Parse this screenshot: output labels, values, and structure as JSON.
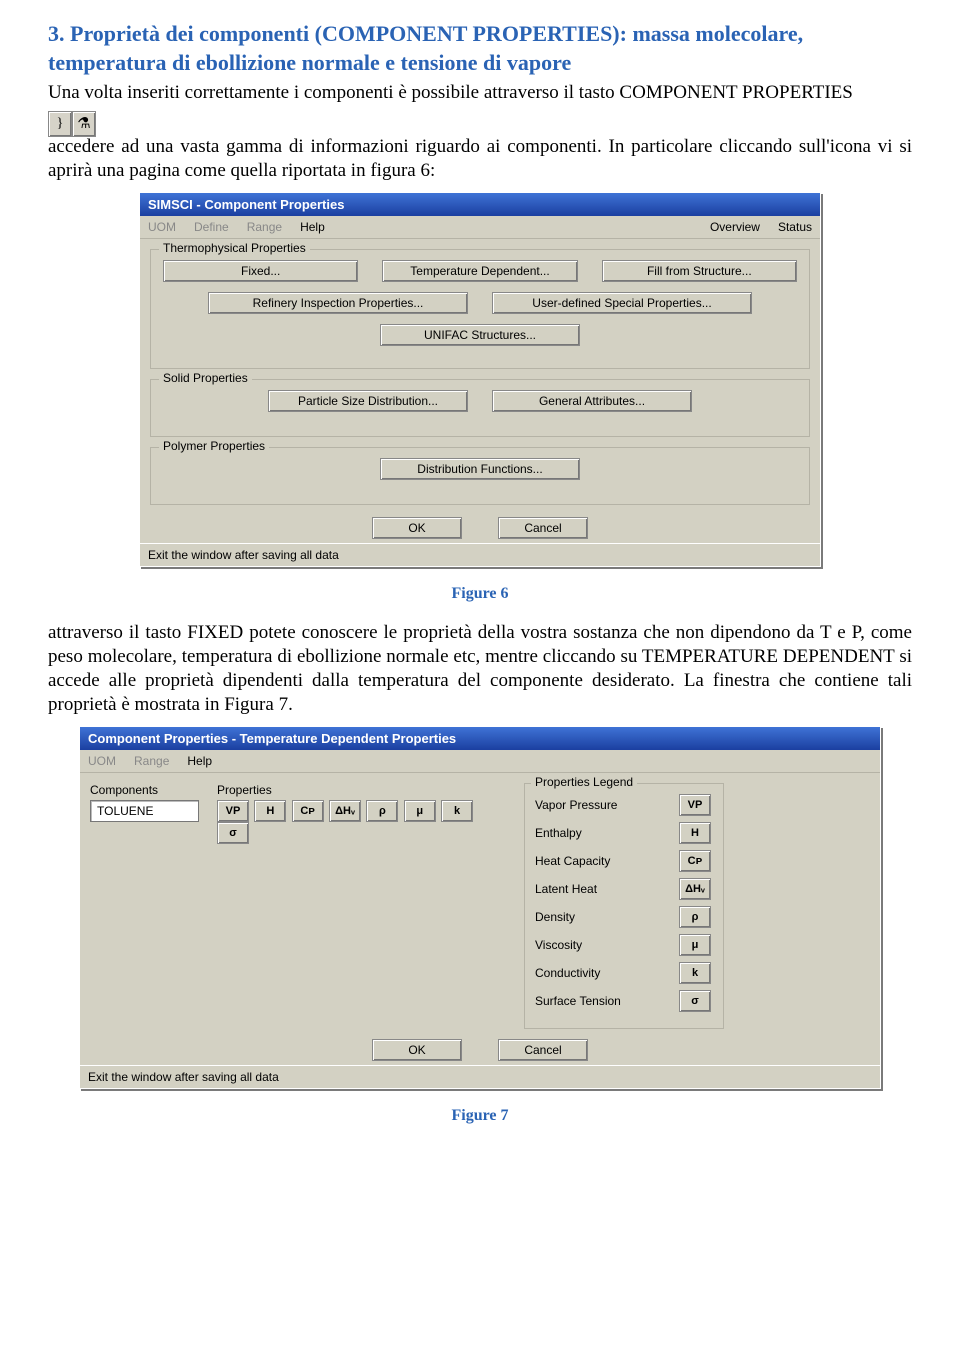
{
  "heading": "3. Proprietà dei componenti (COMPONENT PROPERTIES): massa molecolare, temperatura di ebollizione normale e tensione di vapore",
  "para1_a": "Una volta inseriti correttamente i componenti è possibile attraverso il tasto COMPONENT PROPERTIES",
  "para1_b": "accedere ad una vasta gamma di informazioni riguardo ai componenti. In particolare cliccando sull'icona vi si aprirà una pagina come quella riportata in figura 6:",
  "caption1": "Figure 6",
  "para2": "attraverso il tasto FIXED potete conoscere le proprietà della vostra sostanza che non dipendono da T e P, come peso molecolare, temperatura di ebollizione normale etc, mentre cliccando su TEMPERATURE DEPENDENT si accede alle proprietà dipendenti dalla temperatura del componente desiderato. La finestra che contiene tali proprietà è mostrata in Figura 7.",
  "caption2": "Figure 7",
  "win1": {
    "title": "SIMSCI - Component Properties",
    "menu": {
      "uom": "UOM",
      "define": "Define",
      "range": "Range",
      "help": "Help",
      "overview": "Overview",
      "status": "Status"
    },
    "thermo": {
      "legend": "Thermophysical Properties",
      "fixed": "Fixed...",
      "tempdep": "Temperature Dependent...",
      "fillstruct": "Fill from Structure...",
      "refinery": "Refinery Inspection Properties...",
      "userdef": "User-defined Special Properties...",
      "unifac": "UNIFAC Structures..."
    },
    "solid": {
      "legend": "Solid Properties",
      "psd": "Particle Size Distribution...",
      "general": "General Attributes..."
    },
    "polymer": {
      "legend": "Polymer Properties",
      "dist": "Distribution Functions..."
    },
    "ok": "OK",
    "cancel": "Cancel",
    "status": "Exit the window after saving all data"
  },
  "win2": {
    "title": "Component Properties - Temperature Dependent Properties",
    "menu": {
      "uom": "UOM",
      "range": "Range",
      "help": "Help"
    },
    "components_label": "Components",
    "properties_label": "Properties",
    "component_value": "TOLUENE",
    "prop_btns": [
      "VP",
      "H",
      "Cᴘ",
      "ΔHᵥ",
      "ρ",
      "μ",
      "k",
      "σ"
    ],
    "legend": {
      "title": "Properties Legend",
      "items": [
        {
          "name": "Vapor Pressure",
          "sym": "VP"
        },
        {
          "name": "Enthalpy",
          "sym": "H"
        },
        {
          "name": "Heat Capacity",
          "sym": "Cᴘ"
        },
        {
          "name": "Latent Heat",
          "sym": "ΔHᵥ"
        },
        {
          "name": "Density",
          "sym": "ρ"
        },
        {
          "name": "Viscosity",
          "sym": "μ"
        },
        {
          "name": "Conductivity",
          "sym": "k"
        },
        {
          "name": "Surface Tension",
          "sym": "σ"
        }
      ]
    },
    "ok": "OK",
    "cancel": "Cancel",
    "status": "Exit the window after saving all data"
  }
}
